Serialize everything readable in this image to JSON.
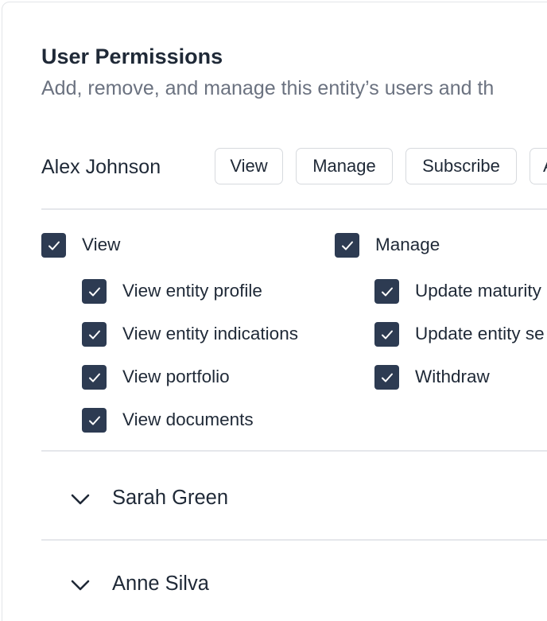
{
  "header": {
    "title": "User Permissions",
    "subtitle": "Add, remove, and manage this entity’s users and th"
  },
  "expanded_user": {
    "name": "Alex Johnson",
    "role_buttons": [
      "View",
      "Manage",
      "Subscribe",
      "A"
    ],
    "groups": [
      {
        "label": "View",
        "checked": true,
        "items": [
          {
            "label": "View entity profile",
            "checked": true
          },
          {
            "label": "View entity indications",
            "checked": true
          },
          {
            "label": "View portfolio",
            "checked": true
          },
          {
            "label": "View documents",
            "checked": true
          }
        ]
      },
      {
        "label": "Manage",
        "checked": true,
        "items": [
          {
            "label": "Update maturity",
            "checked": true
          },
          {
            "label": "Update entity se",
            "checked": true
          },
          {
            "label": "Withdraw",
            "checked": true
          }
        ]
      }
    ]
  },
  "collapsed_users": [
    {
      "name": "Sarah Green"
    },
    {
      "name": "Anne Silva"
    }
  ],
  "colors": {
    "checkbox": "#2d3b52",
    "text": "#1f2937",
    "muted": "#6b7280",
    "border": "#d7dade"
  },
  "icons": {
    "checkbox": "check-icon",
    "expand": "chevron-down-icon"
  }
}
